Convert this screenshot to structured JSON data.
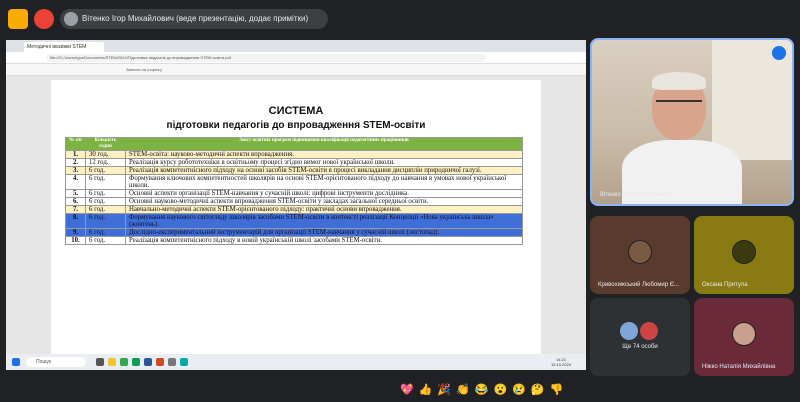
{
  "meet": {
    "presenter_label": "Вітенко Ігор Михайлович (веде презентацію, додає примітки)",
    "participants": [
      {
        "name": "Вітенко Ігор Михайлович"
      },
      {
        "name": "Кривохижський Любомир Є..."
      },
      {
        "name": "Оксана Притула"
      },
      {
        "name": "Ще 74 особи"
      },
      {
        "name": "Ніжко Наталія Михайлівна"
      }
    ],
    "reactions": [
      "💖",
      "👍",
      "🎉",
      "👏",
      "😂",
      "😮",
      "😢",
      "🤔",
      "👎"
    ]
  },
  "browser": {
    "tab_title": "Методичні вказівки STEM",
    "url": "file:///C:/Users/Igor/Documents/STEM/2024/Підготовка педагогів до впровадження STEM-освіти.pdf",
    "zoom": "Змінить на сторінці"
  },
  "slide": {
    "title": "СИСТЕМА",
    "subtitle": "підготовки педагогів до впровадження STEM-освіти",
    "headers": {
      "num": "№ з/п",
      "hours": "Кількість годин",
      "content": "Зміст освітніх програм підвищення кваліфікації педагогічних працівників"
    },
    "rows": [
      {
        "n": "1.",
        "h": "30 год.",
        "t": "STEM-освіта: науково-методичні аспекти впровадження."
      },
      {
        "n": "2.",
        "h": "12 год.",
        "t": "Реалізація курсу робототехніки в освітньому процесі згідно вимог нової української школи."
      },
      {
        "n": "3.",
        "h": "6 год.",
        "t": "Реалізація компетентнісного підходу на основі засобів STEM-освіти в процесі викладання дисциплін природничої галузі."
      },
      {
        "n": "4.",
        "h": "6 год.",
        "t": "Формування ключових компетентностей школярів на основі STEM-орієнтованого підходу до навчання в умовах нової української школи."
      },
      {
        "n": "5.",
        "h": "6 год.",
        "t": "Основні аспекти організації STEM-навчання у сучасній школі: цифрові інструменти дослідника."
      },
      {
        "n": "6.",
        "h": "6 год.",
        "t": "Основні науково-методичні аспекти впровадження STEM-освіти у закладах загальної середньої освіти."
      },
      {
        "n": "7.",
        "h": "6 год.",
        "t": "Навчально-методичні аспекти STEM-орієнтованого підходу: практичні основи впровадження."
      },
      {
        "n": "8.",
        "h": "6 год.",
        "t": "Формування наукового світогляду школярів засобами STEM-освіти в контексті реалізації Концепції «Нова українська школа» (жовтень)."
      },
      {
        "n": "9.",
        "h": "6 год.",
        "t": "Дослідно-експериментальний інструментарій для організації STEM-навчання у сучасній школі (листопад)."
      },
      {
        "n": "10.",
        "h": "6 год.",
        "t": "Реалізація компетентнісного підходу в новій українській школі засобами STEM-освіти."
      }
    ]
  },
  "taskbar": {
    "search_placeholder": "Пошук",
    "time": "14:21",
    "date": "15.10.2024"
  }
}
